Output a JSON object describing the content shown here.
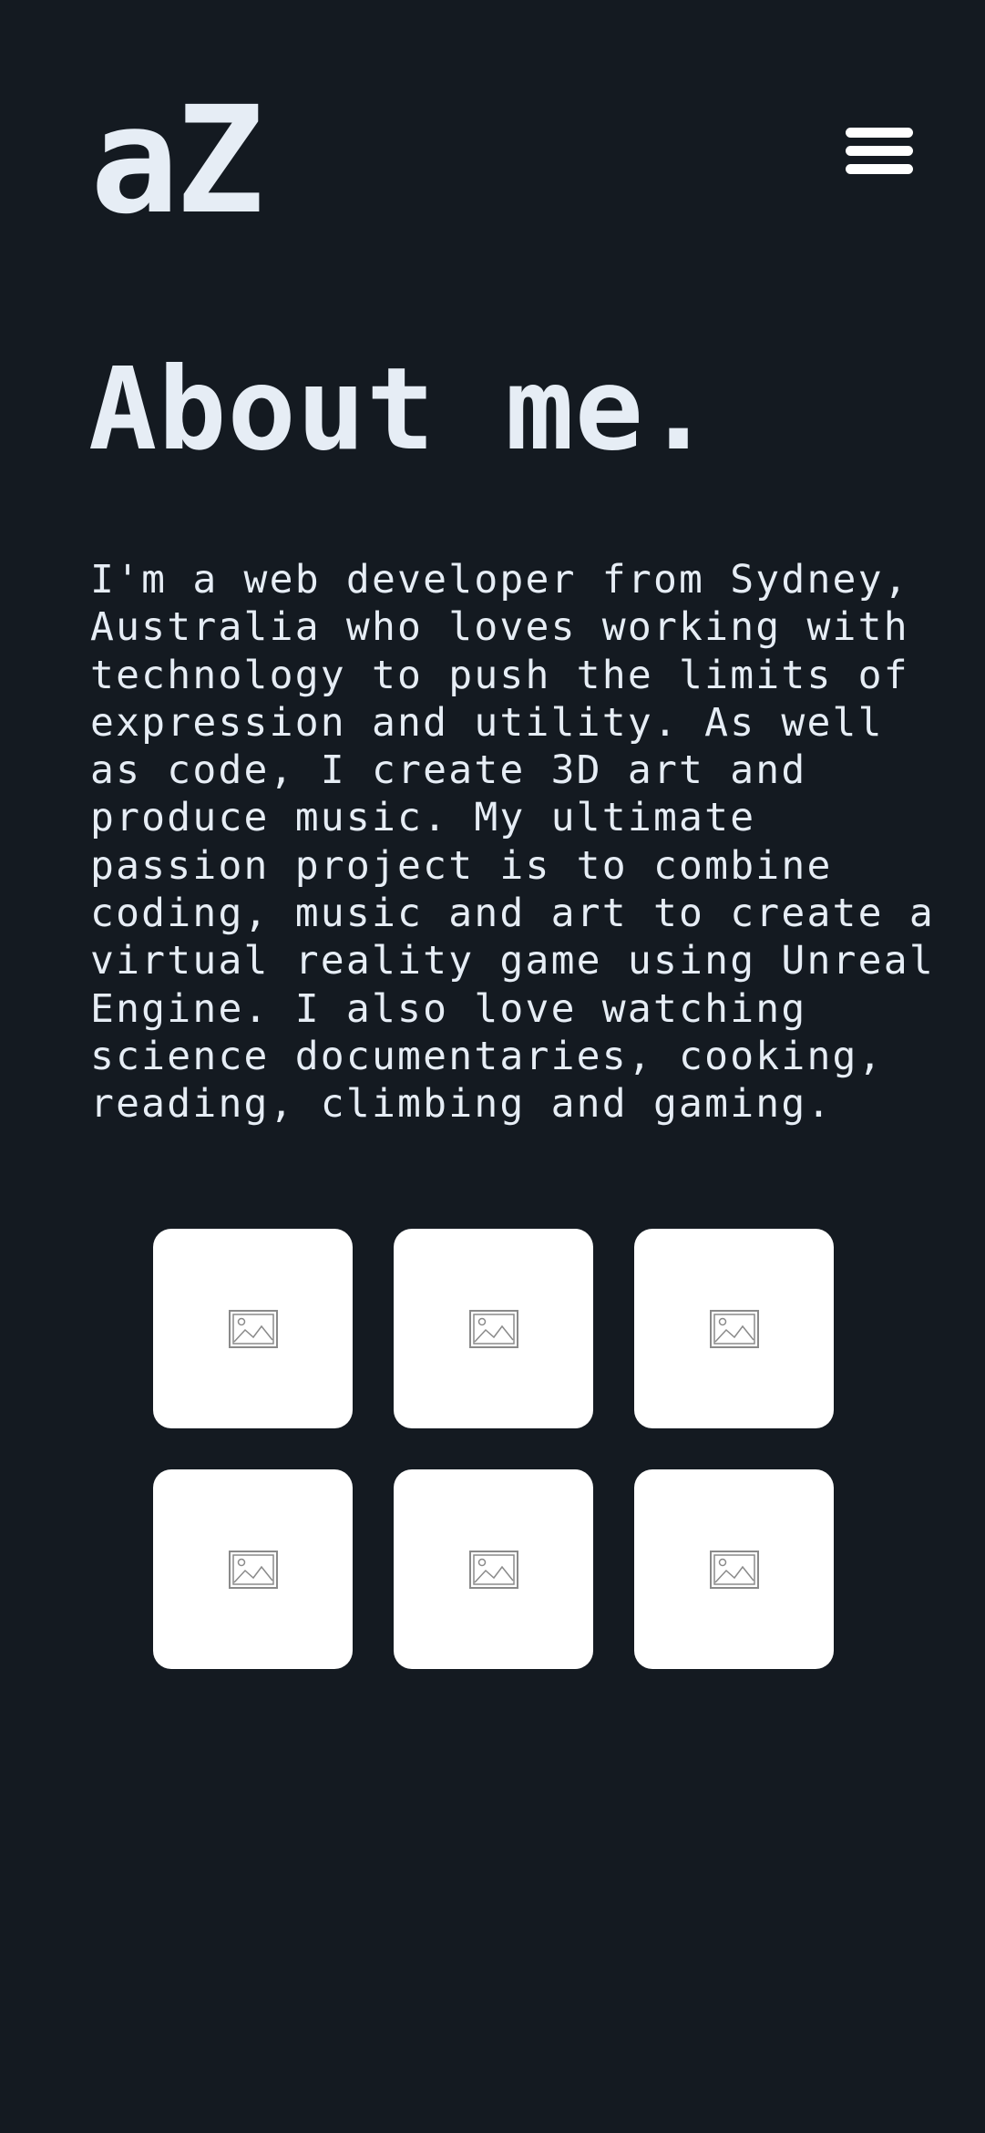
{
  "header": {
    "logo_text": "aZ",
    "menu_icon": "hamburger-menu-icon"
  },
  "main": {
    "title": "About me.",
    "bio": "I'm a web developer from Sydney, Australia who loves working with technology to push the limits of expression and utility. As well as code, I create 3D art and produce music. My ultimate passion project is to combine coding, music and art to create a virtual reality game using Unreal Engine. I also love watching science documentaries, cooking, reading, climbing and gaming."
  },
  "gallery": {
    "tiles": [
      {
        "icon": "image-placeholder-icon"
      },
      {
        "icon": "image-placeholder-icon"
      },
      {
        "icon": "image-placeholder-icon"
      },
      {
        "icon": "image-placeholder-icon"
      },
      {
        "icon": "image-placeholder-icon"
      },
      {
        "icon": "image-placeholder-icon"
      }
    ]
  },
  "colors": {
    "background": "#141a21",
    "text": "#e6edf5",
    "tile": "#ffffff"
  }
}
